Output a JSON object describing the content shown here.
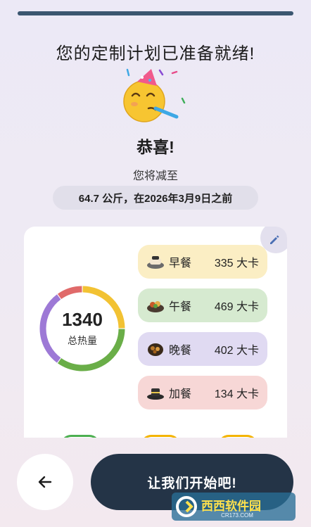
{
  "header": {
    "title": "您的定制计划已准备就绪!"
  },
  "hero": {
    "emoji_icon": "party-face-icon",
    "congrats": "恭喜!",
    "subtitle": "您将减至",
    "goal": "64.7 公斤，在2026年3月9日之前"
  },
  "summary": {
    "total_value": "1340",
    "total_label": "总热量",
    "ring_segments": [
      {
        "name": "早餐",
        "color": "#f2c233",
        "fraction": 0.25
      },
      {
        "name": "午餐",
        "color": "#6aae48",
        "fraction": 0.35
      },
      {
        "name": "晚餐",
        "color": "#9d79d6",
        "fraction": 0.3
      },
      {
        "name": "加餐",
        "color": "#e06a6a",
        "fraction": 0.1
      }
    ],
    "meals": [
      {
        "key": "breakfast",
        "name": "早餐",
        "calories": "335 大卡",
        "icon": "breakfast-icon",
        "color": "#fbeec4"
      },
      {
        "key": "lunch",
        "name": "午餐",
        "calories": "469 大卡",
        "icon": "lunch-icon",
        "color": "#d6ead0"
      },
      {
        "key": "dinner",
        "name": "晚餐",
        "calories": "402 大卡",
        "icon": "dinner-icon",
        "color": "#e0daf2"
      },
      {
        "key": "snack",
        "name": "加餐",
        "calories": "134 大卡",
        "icon": "snack-icon",
        "color": "#f7d7d6"
      }
    ],
    "edit_icon": "pencil-icon"
  },
  "footer": {
    "back_icon": "arrow-left-icon",
    "start_label": "让我们开始吧!"
  },
  "watermark": {
    "text": "西西软件园",
    "url": "CR173.COM"
  },
  "colors": {
    "progress": "#3b5670",
    "primary_button": "#243447",
    "accent_edit": "#4a6fb3"
  }
}
